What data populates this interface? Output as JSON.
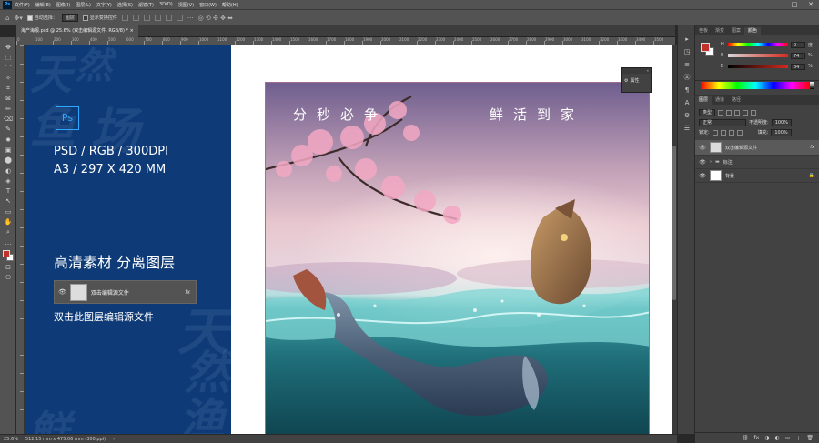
{
  "menubar": {
    "logo": "Ps",
    "items": [
      "文件(F)",
      "编辑(E)",
      "图像(I)",
      "图层(L)",
      "文字(Y)",
      "选择(S)",
      "滤镜(T)",
      "3D(D)",
      "视图(V)",
      "窗口(W)",
      "帮助(H)"
    ],
    "window_controls": [
      "—",
      "□",
      "✕"
    ]
  },
  "options": {
    "auto_select": "自动选择：",
    "auto_select_target": "图层",
    "show_transform": "显示变换控件"
  },
  "document_tab": {
    "title": "海产海报.psd @ 25.6% (双击编辑源文件, RGB/8) *",
    "close": "×"
  },
  "ruler_numbers": [
    "0",
    "100",
    "200",
    "300",
    "400",
    "500",
    "600",
    "700",
    "800",
    "900",
    "1000",
    "1100",
    "1200",
    "1300",
    "1400",
    "1500",
    "1600",
    "1700",
    "1800",
    "1900",
    "2000",
    "2100",
    "2200",
    "2300",
    "2400",
    "2500",
    "2600",
    "2700",
    "2800",
    "2900",
    "3000",
    "3100",
    "3200",
    "3300",
    "3400",
    "3500"
  ],
  "info_panel": {
    "ps_badge": "Ps",
    "spec_line1": "PSD / RGB / 300DPI",
    "spec_line2": "A3 / 297 X 420 MM",
    "headline": "高清素材 分离图层",
    "layer_demo_name": "双击编辑源文件",
    "layer_demo_fx": "fx",
    "hint": "双击此图层编辑源文件",
    "bg_chars": [
      "天",
      "然",
      "鱼",
      "场",
      "天",
      "然",
      "渔",
      "鲜"
    ]
  },
  "poster": {
    "title_left": "分秒必争",
    "title_right": "鲜活到家"
  },
  "properties_popup": {
    "label": "属性",
    "collapse": "«"
  },
  "right_panel": {
    "color_tabs": [
      "色板",
      "渐变",
      "图案",
      "颜色"
    ],
    "colors": {
      "foreground": "#c0322a",
      "background": "#ffffff"
    },
    "sliders": [
      {
        "label": "H",
        "value": "0",
        "unit": "度"
      },
      {
        "label": "S",
        "value": "74",
        "unit": "%"
      },
      {
        "label": "B",
        "value": "84",
        "unit": "%"
      }
    ],
    "layer_tabs": [
      "图层",
      "通道",
      "路径"
    ],
    "kind_filter": "类型",
    "blend_mode": "正常",
    "opacity_label": "不透明度:",
    "opacity_value": "100%",
    "lock_label": "锁定:",
    "fill_label": "填充:",
    "fill_value": "100%",
    "layers": [
      {
        "name": "双击编辑源文件",
        "fx": "fx",
        "type": "smart"
      },
      {
        "name": "标注",
        "type": "group"
      },
      {
        "name": "背景",
        "lock": "🔒",
        "type": "background"
      }
    ],
    "bottom_icons": [
      "⛓",
      "fx",
      "◑",
      "◐",
      "▭",
      "＋",
      "🗑"
    ]
  },
  "status": {
    "zoom": "25.6%",
    "doc_size": "512.15 mm x 475.06 mm (300 ppi)",
    "arrow": "›"
  },
  "tools": [
    "✥",
    "⬚",
    "⌒",
    "✧",
    "⌗",
    "⊠",
    "✏",
    "⌫",
    "✎",
    "✹",
    "▣",
    "⬤",
    "◐",
    "◈",
    "T",
    "↖",
    "▭",
    "✋",
    "⌕",
    "…",
    "■",
    "⊡",
    "⎔"
  ],
  "mini_icons": [
    "▸",
    "◳",
    "≡",
    "Ⓐ",
    "¶",
    "A",
    "⚙",
    "☰"
  ]
}
